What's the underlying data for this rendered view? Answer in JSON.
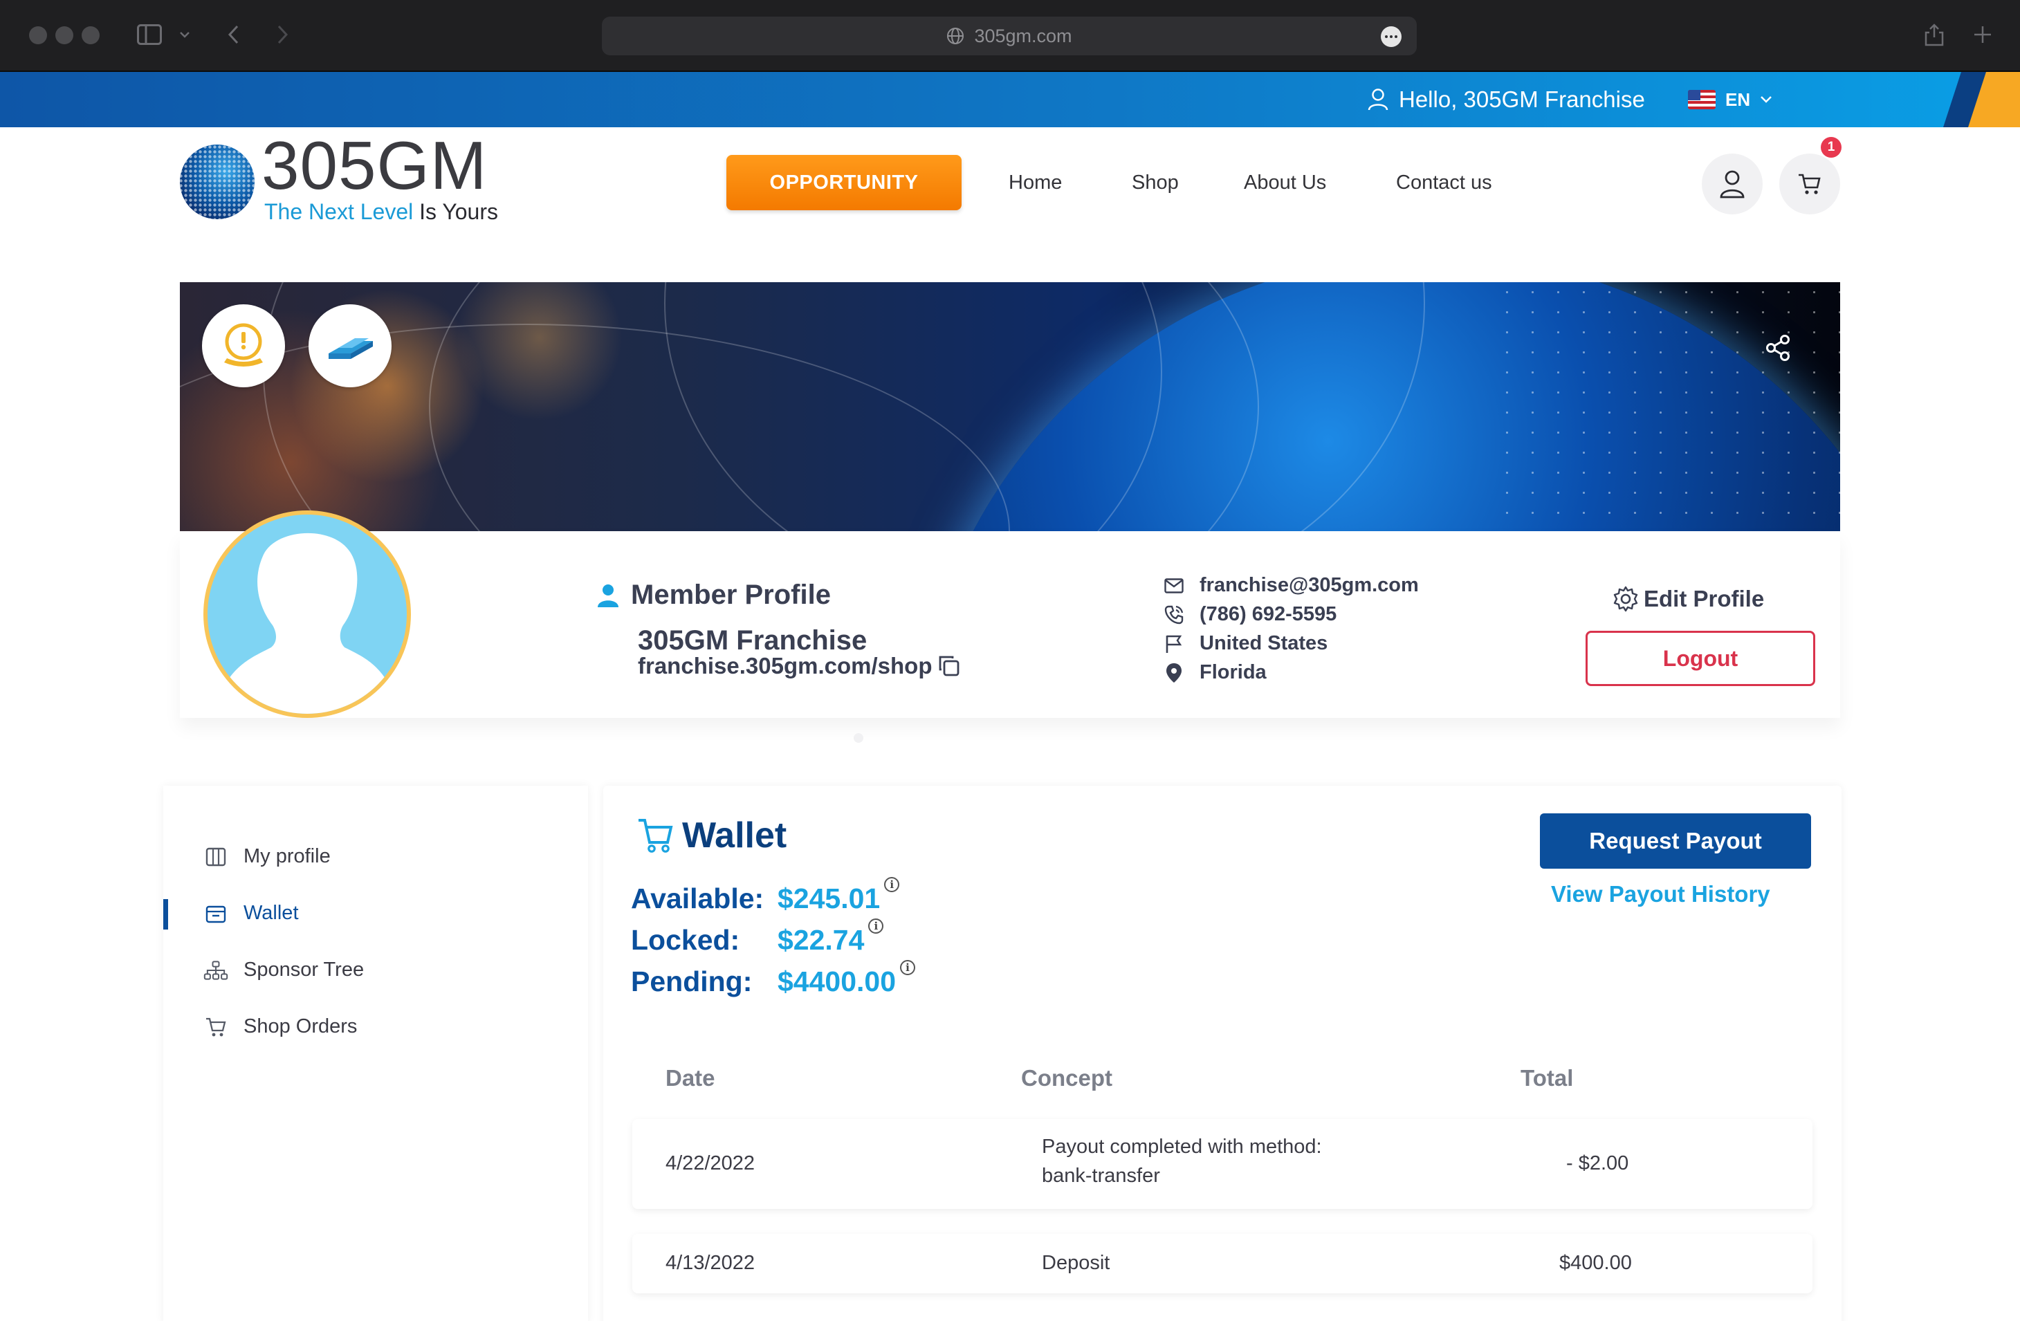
{
  "browser": {
    "url": "305gm.com"
  },
  "topbar": {
    "greeting": "Hello, 305GM Franchise",
    "language": "EN"
  },
  "header": {
    "logo_text": "305GM",
    "tagline_blue": "The Next Level",
    "tagline_dark": "Is Yours",
    "opportunity_label": "OPPORTUNITY",
    "nav": {
      "home": "Home",
      "shop": "Shop",
      "about": "About Us",
      "contact": "Contact us"
    },
    "cart_count": "1"
  },
  "profile": {
    "section_title": "Member Profile",
    "name": "305GM Franchise",
    "shop_url": "franchise.305gm.com/shop",
    "email": "franchise@305gm.com",
    "phone": "(786) 692-5595",
    "country": "United States",
    "state": "Florida",
    "edit_label": "Edit Profile",
    "logout_label": "Logout"
  },
  "sidebar": {
    "items": [
      {
        "label": "My profile",
        "icon": "columns-icon"
      },
      {
        "label": "Wallet",
        "icon": "wallet-icon",
        "active": true
      },
      {
        "label": "Sponsor Tree",
        "icon": "tree-icon"
      },
      {
        "label": "Shop Orders",
        "icon": "cart-icon"
      }
    ]
  },
  "wallet": {
    "title": "Wallet",
    "available_label": "Available:",
    "available_value": "$245.01",
    "locked_label": "Locked:",
    "locked_value": "$22.74",
    "pending_label": "Pending:",
    "pending_value": "$4400.00",
    "request_payout_label": "Request Payout",
    "payout_history_label": "View Payout History",
    "table": {
      "headers": [
        "Date",
        "Concept",
        "Total"
      ],
      "rows": [
        {
          "date": "4/22/2022",
          "concept_line1": "Payout completed with method:",
          "concept_line2": "bank-transfer",
          "total": "- $2.00"
        },
        {
          "date": "4/13/2022",
          "concept_line1": "Deposit",
          "total": "$400.00"
        }
      ]
    }
  },
  "colors": {
    "primary": "#0b4f9c",
    "accent": "#1aa3e0",
    "orange": "#f47a00",
    "danger": "#d9334c"
  }
}
